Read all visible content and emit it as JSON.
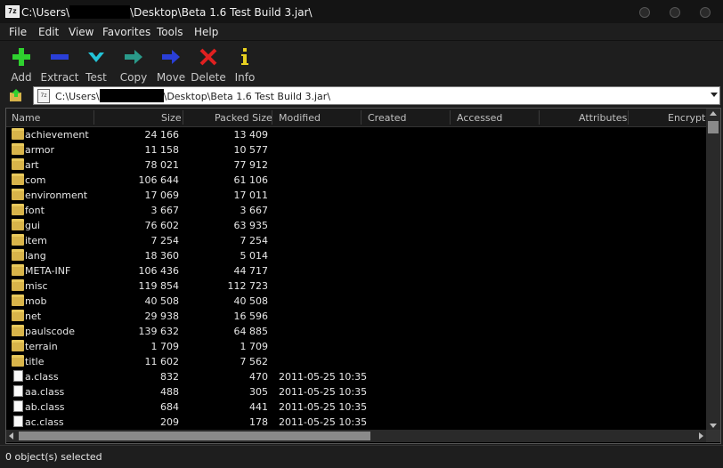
{
  "window": {
    "app_icon_text": "7z",
    "title_prefix": "C:\\Users\\",
    "title_suffix": "\\Desktop\\Beta 1.6 Test Build 3.jar\\"
  },
  "menu": [
    "File",
    "Edit",
    "View",
    "Favorites",
    "Tools",
    "Help"
  ],
  "toolbar": [
    {
      "label": "Add",
      "icon": "plus-icon",
      "color": "#2fd12f"
    },
    {
      "label": "Extract",
      "icon": "minus-icon",
      "color": "#2a3fd8"
    },
    {
      "label": "Test",
      "icon": "check-icon",
      "color": "#23c4d8"
    },
    {
      "label": "Copy",
      "icon": "copy-arrow-icon",
      "color": "#2a9a8a"
    },
    {
      "label": "Move",
      "icon": "move-arrow-icon",
      "color": "#2a3fd8"
    },
    {
      "label": "Delete",
      "icon": "x-icon",
      "color": "#e02020"
    },
    {
      "label": "Info",
      "icon": "info-icon",
      "color": "#e8d020"
    }
  ],
  "address": {
    "prefix": "C:\\Users\\",
    "suffix": "\\Desktop\\Beta 1.6 Test Build 3.jar\\"
  },
  "columns": [
    "Name",
    "Size",
    "Packed Size",
    "Modified",
    "Created",
    "Accessed",
    "Attributes",
    "Encrypte"
  ],
  "rows": [
    {
      "name": "achievement",
      "type": "folder",
      "size": "24 166",
      "packed": "13 409",
      "modified": ""
    },
    {
      "name": "armor",
      "type": "folder",
      "size": "11 158",
      "packed": "10 577",
      "modified": ""
    },
    {
      "name": "art",
      "type": "folder",
      "size": "78 021",
      "packed": "77 912",
      "modified": ""
    },
    {
      "name": "com",
      "type": "folder",
      "size": "106 644",
      "packed": "61 106",
      "modified": ""
    },
    {
      "name": "environment",
      "type": "folder",
      "size": "17 069",
      "packed": "17 011",
      "modified": ""
    },
    {
      "name": "font",
      "type": "folder",
      "size": "3 667",
      "packed": "3 667",
      "modified": ""
    },
    {
      "name": "gui",
      "type": "folder",
      "size": "76 602",
      "packed": "63 935",
      "modified": ""
    },
    {
      "name": "item",
      "type": "folder",
      "size": "7 254",
      "packed": "7 254",
      "modified": ""
    },
    {
      "name": "lang",
      "type": "folder",
      "size": "18 360",
      "packed": "5 014",
      "modified": ""
    },
    {
      "name": "META-INF",
      "type": "folder",
      "size": "106 436",
      "packed": "44 717",
      "modified": ""
    },
    {
      "name": "misc",
      "type": "folder",
      "size": "119 854",
      "packed": "112 723",
      "modified": ""
    },
    {
      "name": "mob",
      "type": "folder",
      "size": "40 508",
      "packed": "40 508",
      "modified": ""
    },
    {
      "name": "net",
      "type": "folder",
      "size": "29 938",
      "packed": "16 596",
      "modified": ""
    },
    {
      "name": "paulscode",
      "type": "folder",
      "size": "139 632",
      "packed": "64 885",
      "modified": ""
    },
    {
      "name": "terrain",
      "type": "folder",
      "size": "1 709",
      "packed": "1 709",
      "modified": ""
    },
    {
      "name": "title",
      "type": "folder",
      "size": "11 602",
      "packed": "7 562",
      "modified": ""
    },
    {
      "name": "a.class",
      "type": "file",
      "size": "832",
      "packed": "470",
      "modified": "2011-05-25 10:35"
    },
    {
      "name": "aa.class",
      "type": "file",
      "size": "488",
      "packed": "305",
      "modified": "2011-05-25 10:35"
    },
    {
      "name": "ab.class",
      "type": "file",
      "size": "684",
      "packed": "441",
      "modified": "2011-05-25 10:35"
    },
    {
      "name": "ac.class",
      "type": "file",
      "size": "209",
      "packed": "178",
      "modified": "2011-05-25 10:35"
    }
  ],
  "status": "0 object(s) selected"
}
